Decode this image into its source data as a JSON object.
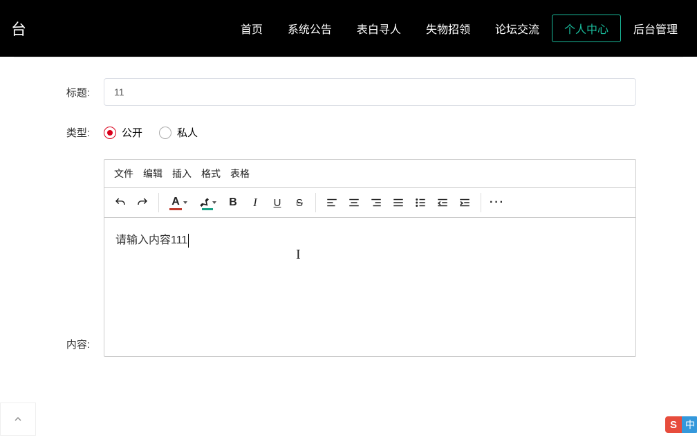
{
  "navbar": {
    "logo": "台",
    "items": [
      {
        "label": "首页",
        "active": false
      },
      {
        "label": "系统公告",
        "active": false
      },
      {
        "label": "表白寻人",
        "active": false
      },
      {
        "label": "失物招领",
        "active": false
      },
      {
        "label": "论坛交流",
        "active": false
      },
      {
        "label": "个人中心",
        "active": true
      },
      {
        "label": "后台管理",
        "active": false
      }
    ]
  },
  "form": {
    "title_label": "标题:",
    "title_value": "11",
    "type_label": "类型:",
    "type_options": [
      {
        "label": "公开",
        "checked": true
      },
      {
        "label": "私人",
        "checked": false
      }
    ],
    "content_label": "内容:"
  },
  "editor": {
    "menubar": [
      "文件",
      "编辑",
      "插入",
      "格式",
      "表格"
    ],
    "content": "请输入内容111",
    "colors": {
      "text_color": "#c0392b",
      "highlight_color": "#16a085"
    }
  },
  "ime": {
    "brand": "S",
    "lang": "中"
  }
}
